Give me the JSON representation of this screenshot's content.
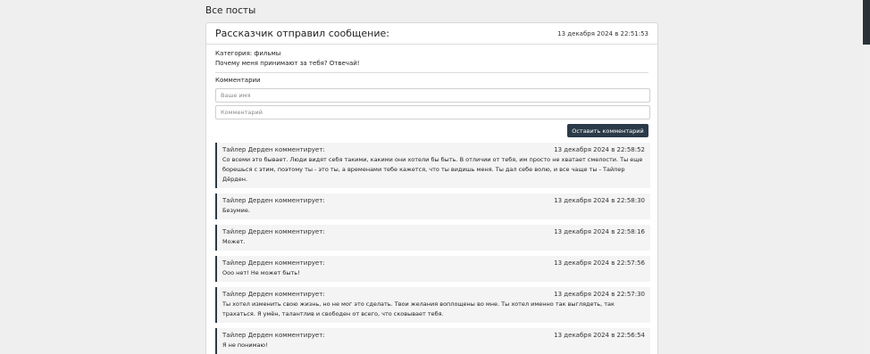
{
  "page": {
    "heading": "Все посты"
  },
  "post": {
    "title": "Рассказчик отправил сообщение:",
    "date": "13 декабря 2024 в 22:51:53",
    "category": "Категория: фильмы",
    "text": "Почему меня принимают за тебя? Отвечай!",
    "comments_label": "Комментарии",
    "name_placeholder": "Ваше имя",
    "comment_placeholder": "Комментарий",
    "submit_label": "Оставить комментарий"
  },
  "comments": [
    {
      "author": "Тайлер Дерден  комментирует:",
      "date": "13 декабря 2024 в 22:58:52",
      "text": "Со всеми это бывает. Люди видят себя такими, какими они хотели бы быть. В отличии от тебя, им просто не хватает смелости. Ты еще борешься с этим, поэтому ты - это ты, а временами тебе кажется, что ты видишь меня. Ты дал себе волю, и все чаще ты - Тайлер Дёрден."
    },
    {
      "author": "Тайлер Дерден  комментирует:",
      "date": "13 декабря 2024 в 22:58:30",
      "text": "Безумие."
    },
    {
      "author": "Тайлер Дерден  комментирует:",
      "date": "13 декабря 2024 в 22:58:16",
      "text": "Может."
    },
    {
      "author": "Тайлер Дерден  комментирует:",
      "date": "13 декабря 2024 в 22:57:56",
      "text": "Ооо нет! Не может быть!"
    },
    {
      "author": "Тайлер Дерден  комментирует:",
      "date": "13 декабря 2024 в 22:57:30",
      "text": "Ты хотел изменить свою жизнь, но не мог это сделать. Твои желания воплощены во мне. Ты хотел именно так выглядеть, так трахаться. Я умён, талантлив и свободен от всего, что сковывает тебя."
    },
    {
      "author": "Тайлер Дерден  комментирует:",
      "date": "13 декабря 2024 в 22:56:54",
      "text": "Я не понимаю!"
    }
  ],
  "colors": {
    "accent": "#2b3a48",
    "background": "#efefef"
  }
}
